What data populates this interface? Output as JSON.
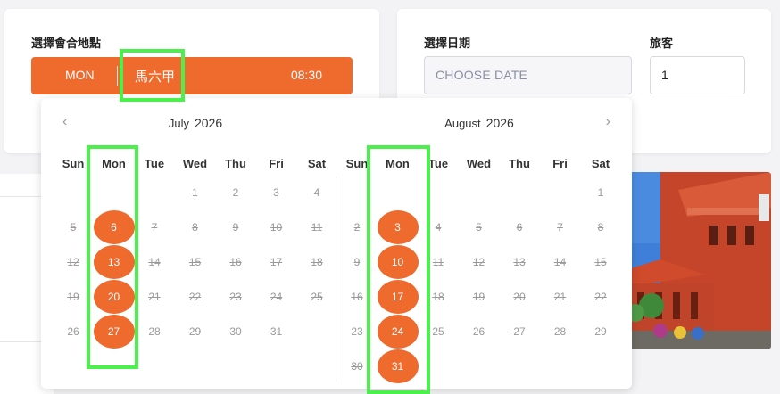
{
  "meeting": {
    "label": "選擇會合地點",
    "day": "MON",
    "place": "馬六甲",
    "time": "08:30"
  },
  "date": {
    "label": "選擇日期",
    "placeholder": "CHOOSE DATE"
  },
  "travelers": {
    "label": "旅客",
    "value": "1"
  },
  "calendar": {
    "weekdays": [
      "Sun",
      "Mon",
      "Tue",
      "Wed",
      "Thu",
      "Fri",
      "Sat"
    ],
    "months": [
      {
        "name": "July",
        "year": "2026",
        "first_weekday": 3,
        "days": 31,
        "available": [
          6,
          13,
          20,
          27
        ]
      },
      {
        "name": "August",
        "year": "2026",
        "first_weekday": 6,
        "days": 31,
        "available": [
          3,
          10,
          17,
          24,
          31
        ]
      }
    ]
  },
  "accent_color": "#ee6a2d",
  "highlight_color": "#4cf04c"
}
